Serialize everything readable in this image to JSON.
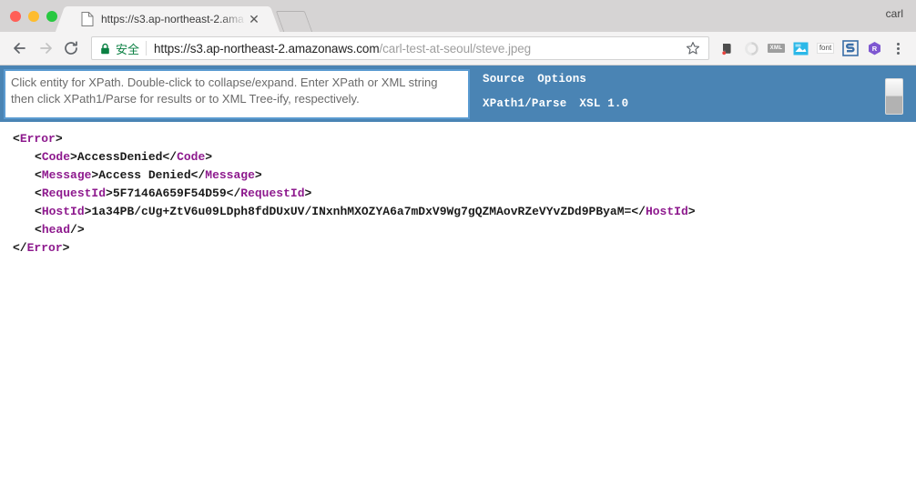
{
  "window": {
    "profile_name": "carl",
    "traffic_lights": [
      "close",
      "minimize",
      "maximize"
    ]
  },
  "tab": {
    "title": "https://s3.ap-northeast-2.ama",
    "favicon": "page-icon",
    "close_glyph": "✕",
    "new_tab_label": ""
  },
  "toolbar": {
    "back_label": "Back",
    "forward_label": "Forward",
    "reload_label": "Reload",
    "security_text": "安全",
    "url_host": "https://s3.ap-northeast-2.amazonaws.com",
    "url_path": "/carl-test-at-seoul/steve.jpeg",
    "star_glyph": "☆",
    "extensions": [
      {
        "name": "evernote-extension-icon",
        "label": ""
      },
      {
        "name": "circle-extension-icon",
        "label": ""
      },
      {
        "name": "xml-extension-icon",
        "label": "XML"
      },
      {
        "name": "screenshot-extension-icon",
        "label": ""
      },
      {
        "name": "font-extension-icon",
        "label": "font"
      },
      {
        "name": "s-extension-icon",
        "label": "S"
      },
      {
        "name": "r-extension-icon",
        "label": "R"
      }
    ],
    "menu_label": "Customize and control"
  },
  "xpath_tool": {
    "input_value": "",
    "input_placeholder": "Click entity for XPath. Double-click to collapse/expand. Enter XPath or XML string then click XPath1/Parse for results or to XML Tree-ify, respectively.",
    "menu_row_1": [
      {
        "label": "Source"
      },
      {
        "label": "Options"
      }
    ],
    "menu_row_2": [
      {
        "label": "XPath1/Parse"
      },
      {
        "label": "XSL 1.0"
      }
    ],
    "accent_color": "#4a84b4",
    "tag_color": "#8e1a8e"
  },
  "xml_tree": {
    "lines": [
      {
        "indent": 0,
        "open_lt": "<",
        "open_tag": "Error",
        "open_gt": ">",
        "text": "",
        "close_lt": "",
        "close_tag": "",
        "close_gt": ""
      },
      {
        "indent": 1,
        "open_lt": "<",
        "open_tag": "Code",
        "open_gt": ">",
        "text": "AccessDenied",
        "close_lt": "</",
        "close_tag": "Code",
        "close_gt": ">"
      },
      {
        "indent": 1,
        "open_lt": "<",
        "open_tag": "Message",
        "open_gt": ">",
        "text": "Access Denied",
        "close_lt": "</",
        "close_tag": "Message",
        "close_gt": ">"
      },
      {
        "indent": 1,
        "open_lt": "<",
        "open_tag": "RequestId",
        "open_gt": ">",
        "text": "5F7146A659F54D59",
        "close_lt": "</",
        "close_tag": "RequestId",
        "close_gt": ">"
      },
      {
        "indent": 1,
        "open_lt": "<",
        "open_tag": "HostId",
        "open_gt": ">",
        "text": "1a34PB/cUg+ZtV6u09LDph8fdDUxUV/INxnhMXOZYA6a7mDxV9Wg7gQZMAovRZeVYvZDd9PByaM=",
        "close_lt": "</",
        "close_tag": "HostId",
        "close_gt": ">"
      },
      {
        "indent": 1,
        "open_lt": "<",
        "open_tag": "head",
        "open_gt": "/>",
        "text": "",
        "close_lt": "",
        "close_tag": "",
        "close_gt": ""
      },
      {
        "indent": 0,
        "open_lt": "</",
        "open_tag": "Error",
        "open_gt": ">",
        "text": "",
        "close_lt": "",
        "close_tag": "",
        "close_gt": ""
      }
    ]
  }
}
